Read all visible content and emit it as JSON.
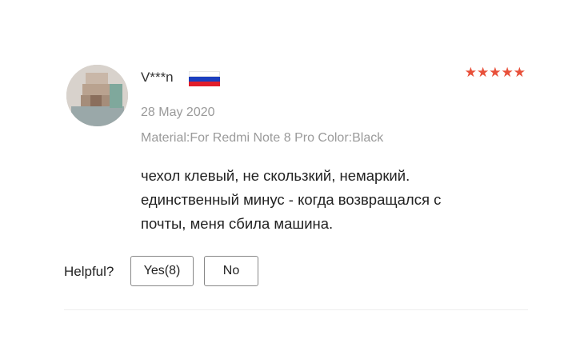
{
  "review": {
    "reviewer_name": "V***n",
    "country_flag": {
      "name": "russia-flag-icon",
      "colors": [
        "#ffffff",
        "#1c3fbf",
        "#e11e2b"
      ]
    },
    "rating": 5,
    "stars": "★★★★★",
    "date": "28 May 2020",
    "sku": "Material:For Redmi Note 8 Pro Color:Black",
    "text_lines": [
      "чехол клевый, не скользкий, немаркий.",
      "единственный минус - когда возвращался с",
      "почты, меня сбила машина."
    ]
  },
  "helpful": {
    "label": "Helpful?",
    "yes_label": "Yes(8)",
    "no_label": "No"
  },
  "colors": {
    "star": "#e8503a",
    "meta_text": "#9a9a9a"
  }
}
